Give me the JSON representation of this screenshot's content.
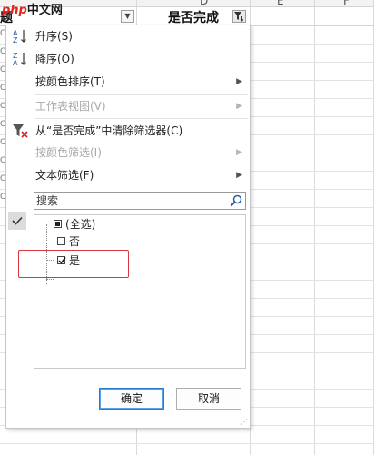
{
  "sheet": {
    "logo_prefix": "php",
    "logo_text": "中文网",
    "column_letters": [
      "D",
      "E",
      "F"
    ],
    "header_left_text": "题",
    "header_done_text": "是否完成",
    "left_stub_glyph": "O"
  },
  "menu": {
    "sort_asc": "升序(S)",
    "sort_desc": "降序(O)",
    "sort_by_color": "按颜色排序(T)",
    "sheet_view": "工作表视图(V)",
    "clear_filter": "从“是否完成”中清除筛选器(C)",
    "filter_by_color": "按颜色筛选(I)",
    "text_filter": "文本筛选(F)",
    "submenu_arrow": "▶"
  },
  "search": {
    "placeholder": "搜索",
    "icon": "search-icon"
  },
  "filter_list": {
    "items": [
      {
        "label": "(全选)",
        "state": "partial"
      },
      {
        "label": "否",
        "state": "unchecked"
      },
      {
        "label": "是",
        "state": "checked"
      }
    ]
  },
  "buttons": {
    "ok": "确定",
    "cancel": "取消"
  },
  "colors": {
    "highlight": "#d9363e",
    "primary_button_border": "#2a7bd6",
    "clear_filter_icon": "#cc2222"
  }
}
